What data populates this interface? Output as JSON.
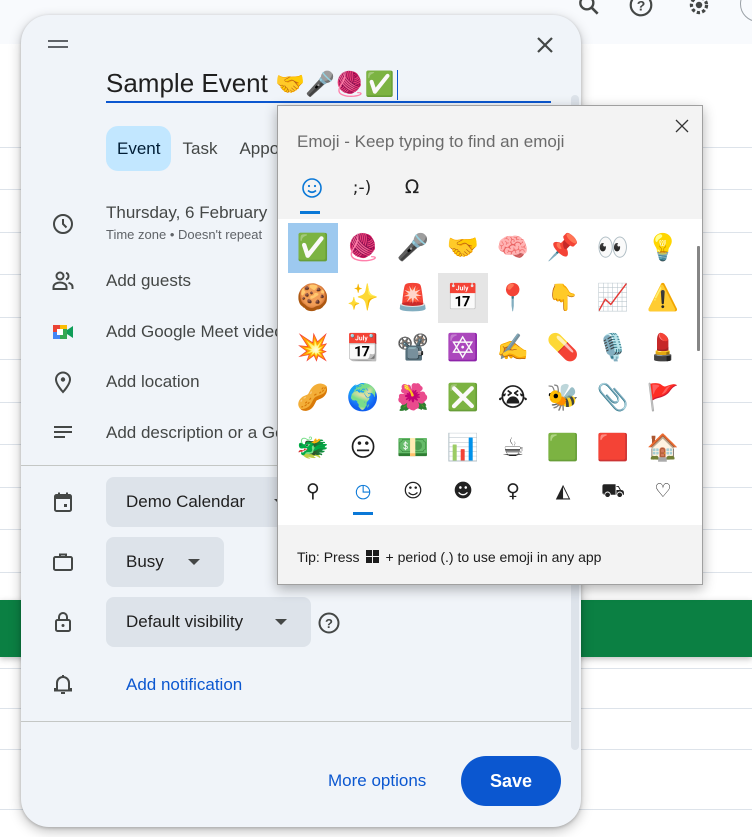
{
  "background": {
    "header_icons": [
      "search-icon",
      "help-icon",
      "settings-icon",
      "account-avatar"
    ],
    "event_bar_color": "#0b8043"
  },
  "dialog": {
    "title_value": "Sample Event 🫱🏼‍🫲🏽🎤🧶✅",
    "title_text": "Sample Event",
    "title_emojis": [
      "🤝",
      "🎤",
      "🧶",
      "✅"
    ],
    "tabs": [
      {
        "label": "Event",
        "active": true
      },
      {
        "label": "Task",
        "active": false
      },
      {
        "label": "Appointment schedule",
        "active": false
      }
    ],
    "date_text": "Thursday, 6 February",
    "date_sub": "Time zone • Doesn't repeat",
    "rows": {
      "guests": "Add guests",
      "meet": "Add Google Meet video conferencing",
      "location": "Add location",
      "description": "Add description or a Google Drive attachment"
    },
    "calendar_select": "Demo Calendar",
    "availability_select": "Busy",
    "visibility_select": "Default visibility",
    "add_notification": "Add notification",
    "more_options": "More options",
    "save": "Save",
    "accent_color": "#0b57d0"
  },
  "emoji_panel": {
    "title": "Emoji - Keep typing to find an emoji",
    "categories": [
      {
        "label": "☺",
        "name": "emoji",
        "active": true
      },
      {
        "label": ";-)",
        "name": "kaomoji",
        "active": false
      },
      {
        "label": "Ω",
        "name": "symbols",
        "active": false
      }
    ],
    "grid": [
      [
        "✅",
        "🧶",
        "🎤",
        "🤝",
        "🧠",
        "📌",
        "👀",
        "💡"
      ],
      [
        "🍪",
        "✨",
        "🚨",
        "📅",
        "📍",
        "👇",
        "📈",
        "⚠️"
      ],
      [
        "💥",
        "📆",
        "📽️",
        "🔯",
        "✍️",
        "💊",
        "🎙️",
        "💄"
      ],
      [
        "🥜",
        "🌍",
        "🌺",
        "❎",
        "😭",
        "🐝",
        "📎",
        "🚩"
      ],
      [
        "🐲",
        "😐",
        "💵",
        "📊",
        "☕",
        "🟩",
        "🟥",
        "🏠"
      ]
    ],
    "selected_emoji": "✅",
    "hovered_emoji": "📅",
    "nav": [
      {
        "icon": "search-icon",
        "glyph": "⚲",
        "active": false
      },
      {
        "icon": "recent-clock-icon",
        "glyph": "◷",
        "active": true
      },
      {
        "icon": "smiley-icon",
        "glyph": "☺",
        "active": false
      },
      {
        "icon": "people-icon",
        "glyph": "☻",
        "active": false
      },
      {
        "icon": "balloon-icon",
        "glyph": "♀",
        "active": false
      },
      {
        "icon": "food-pizza-icon",
        "glyph": "◭",
        "active": false
      },
      {
        "icon": "car-icon",
        "glyph": "⛟",
        "active": false
      },
      {
        "icon": "heart-icon",
        "glyph": "♡",
        "active": false
      }
    ],
    "tip_prefix": "Tip: Press",
    "tip_suffix": "+ period (.) to use emoji in any app"
  }
}
